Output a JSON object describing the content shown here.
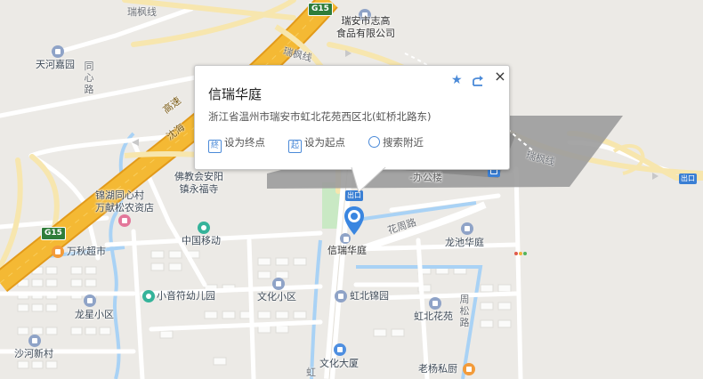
{
  "popup": {
    "title": "信瑞华庭",
    "address": "浙江省温州市瑞安市虹北花苑西区北(虹桥北路东)",
    "set_end_label": "设为终点",
    "set_end_icon_text": "終",
    "set_start_label": "设为起点",
    "set_start_icon_text": "起",
    "search_nearby_label": "搜索附近",
    "icons": {
      "favorite": "star-icon",
      "share": "share-icon",
      "close": "close-icon",
      "nearby": "search-icon"
    }
  },
  "map": {
    "marker_label": "信瑞华庭",
    "road_labels": {
      "ruifeng_top": "瑞枫线",
      "ruifeng_mid": "瑞枫线",
      "ruifeng_right": "瑞枫线",
      "shenhai_a": "沈海",
      "shenhai_b": "高速",
      "huazhou": "花周路",
      "tongxin": "同心路",
      "zhousong": "周松路",
      "hong_bottom": "虹"
    },
    "highway_shields": {
      "top": "G15",
      "left": "G15"
    },
    "exits": {
      "right": "出口",
      "center": "出口"
    },
    "pois": [
      {
        "key": "zhigao",
        "name": "瑞安市志高\n食品有限公司"
      },
      {
        "key": "tianhe",
        "name": "天河嘉园"
      },
      {
        "key": "fojiao",
        "name": "佛教会安阳\n镇永福寺"
      },
      {
        "key": "jinhu",
        "name": "锦湖同心村\n万献松农资店"
      },
      {
        "key": "mobile",
        "name": "中国移动"
      },
      {
        "key": "wanqiu",
        "name": "万秋超市"
      },
      {
        "key": "xiaoyinfu",
        "name": "小音符幼儿园"
      },
      {
        "key": "wenhua_xq",
        "name": "文化小区"
      },
      {
        "key": "hongbei_jy",
        "name": "虹北锦园"
      },
      {
        "key": "longxing",
        "name": "龙星小区"
      },
      {
        "key": "shaxin",
        "name": "沙河新村"
      },
      {
        "key": "longchi",
        "name": "龙池华庭"
      },
      {
        "key": "hongbei_hy",
        "name": "虹北花苑"
      },
      {
        "key": "wenhua_ds",
        "name": "文化大厦"
      },
      {
        "key": "laoyang",
        "name": "老杨私厨"
      },
      {
        "key": "office",
        "name": "-办公楼"
      }
    ],
    "colors": {
      "highway": "#f4b934",
      "highway_edge": "#e29a1a",
      "road": "#ffffff",
      "water": "#a9d2f5",
      "green": "#c9e9c4",
      "building": "#dcdad6",
      "accent": "#3a86e0"
    }
  }
}
